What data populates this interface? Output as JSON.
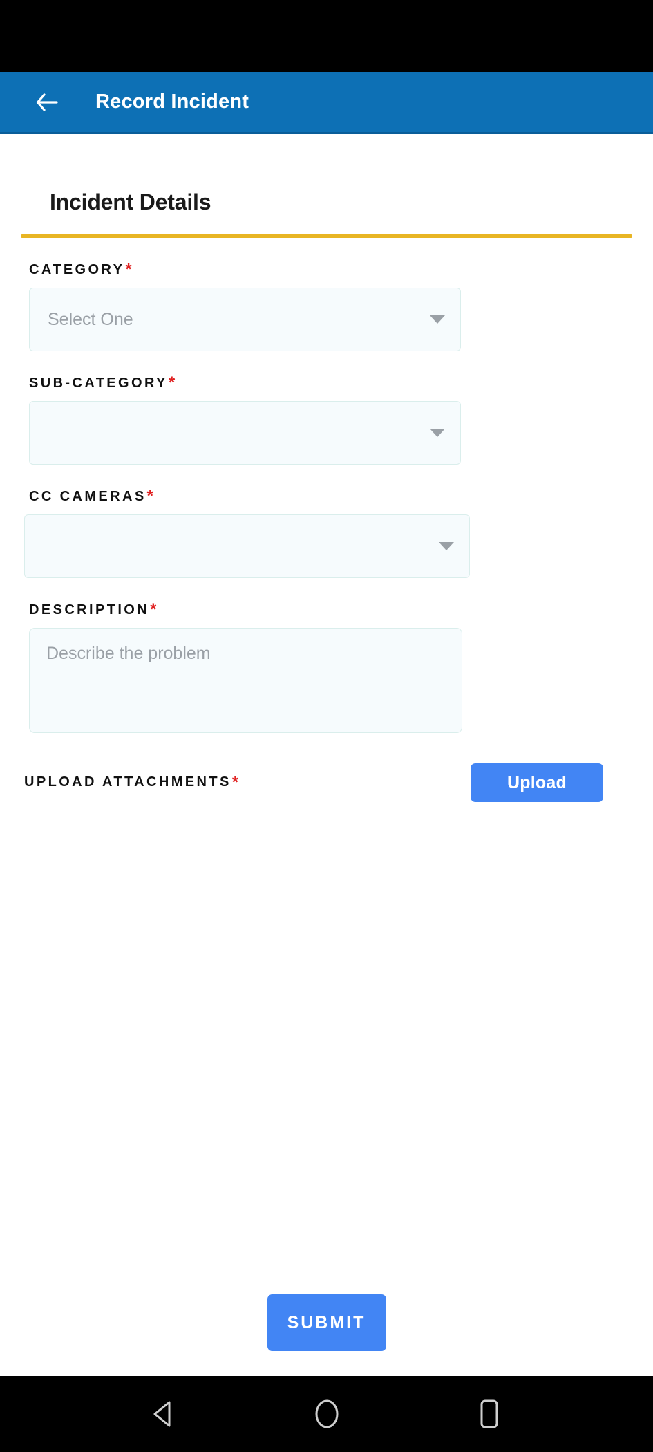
{
  "app_bar": {
    "back_icon": "arrow-left-icon",
    "title": "Record Incident",
    "background_color": "#0d70b5"
  },
  "page": {
    "section_title": "Incident Details",
    "divider_color": "#e8b524"
  },
  "form": {
    "required_marker": "*",
    "fields": [
      {
        "label": "CATEGORY",
        "required": true,
        "type": "select",
        "value": "",
        "placeholder": "Select One",
        "caret_icon": "chevron-down-icon"
      },
      {
        "label": "SUB-CATEGORY",
        "required": true,
        "type": "select",
        "value": "",
        "placeholder": "",
        "caret_icon": "chevron-down-icon"
      },
      {
        "label": "CC CAMERAS",
        "required": true,
        "type": "select",
        "value": "",
        "placeholder": "",
        "caret_icon": "chevron-down-icon"
      },
      {
        "label": "DESCRIPTION",
        "required": true,
        "type": "textarea",
        "value": "",
        "placeholder": "Describe the problem"
      }
    ],
    "upload": {
      "label": "UPLOAD ATTACHMENTS",
      "required": true,
      "button_label": "Upload",
      "button_color": "#4285f4"
    },
    "submit": {
      "label": "SUBMIT",
      "button_color": "#4285f4"
    }
  },
  "nav_bar": {
    "back_icon": "triangle-back-icon",
    "home_icon": "circle-home-icon",
    "recents_icon": "square-recents-icon",
    "background_color": "#000000"
  }
}
